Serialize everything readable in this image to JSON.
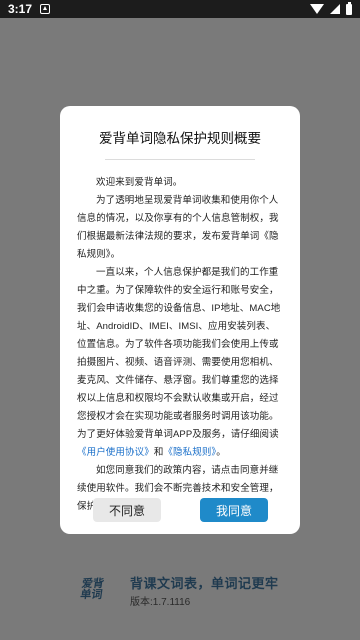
{
  "status_bar": {
    "time": "3:17"
  },
  "dialog": {
    "title": "爱背单词隐私保护规则概要",
    "paragraph_1": "欢迎来到爱背单词。",
    "paragraph_2": "为了透明地呈现爱背单词收集和使用你个人信息的情况，以及你享有的个人信息管制权，我们根据最新法律法规的要求，发布爱背单词《隐私规则》。",
    "paragraph_3_part1": "一直以来，个人信息保护都是我们的工作重中之重。为了保障软件的安全运行和账号安全，我们会申请收集您的设备信息、IP地址、MAC地址、AndroidID、IMEI、IMSI、应用安装列表、位置信息。为了软件各项功能我们会使用上传或拍摄图片、视频、语音评测、需要使用您相机、麦克风、文件储存、悬浮窗。我们尊重您的选择权以上信息和权限均不会默认收集或开启，经过您授权才会在实现功能或者服务时调用该功能。为了更好体验爱背单词APP及服务，请仔细阅读",
    "user_agreement_link": "《用户使用协议》",
    "and_text": "和",
    "privacy_rules_link": "《隐私规则》",
    "paragraph_3_end": "。",
    "paragraph_4": "如您同意我们的政策内容，请点击同意并继续使用软件。我们会不断完善技术和安全管理，保护您的个人信息。",
    "disagree_button": "不同意",
    "agree_button": "我同意"
  },
  "footer": {
    "logo_line1": "爱背",
    "logo_line2": "单词",
    "slogan": "背课文词表，单词记更牢",
    "version": "版本:1.7.1116"
  },
  "colors": {
    "overlay": "#7a7a7a",
    "accent": "#1f8ac9",
    "link": "#1a6fc9",
    "brand_dark": "#1f3a4f"
  }
}
